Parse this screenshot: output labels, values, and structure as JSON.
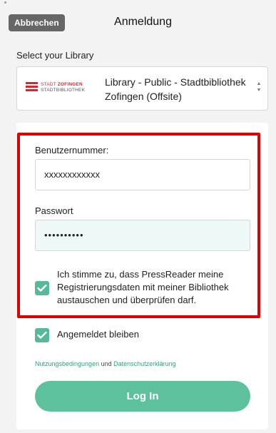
{
  "header": {
    "cancel_label": "Abbrechen",
    "title": "Anmeldung"
  },
  "library": {
    "label": "Select your Library",
    "logo_line1_a": "STADT",
    "logo_line1_b": "ZOFINGEN",
    "logo_line2": "STADTBIBLIOTHEK",
    "selected": "Library - Public - Stadtbibliothek Zofingen (Offsite)",
    "arrow_up": "▲",
    "arrow_down": "▼"
  },
  "form": {
    "username_label": "Benutzernummer:",
    "username_value": "xxxxxxxxxxxx",
    "password_label": "Passwort",
    "password_value": "••••••••••",
    "consent_text": "Ich stimme zu, dass PressReader meine Registrierungsdaten mit meiner Bibliothek austauschen und überprüfen darf.",
    "stay_signed_in": "Angemeldet bleiben",
    "terms_link": "Nutzungsbedingungen",
    "terms_and": "und",
    "privacy_link": "Datenschutzerklärung",
    "login_label": "Log In"
  },
  "colors": {
    "accent": "#5cc19c",
    "highlight_border": "#e00000",
    "logo_red": "#d9232d"
  },
  "icons": {
    "checkbox": "check-icon",
    "select": "select-arrows-icon"
  }
}
